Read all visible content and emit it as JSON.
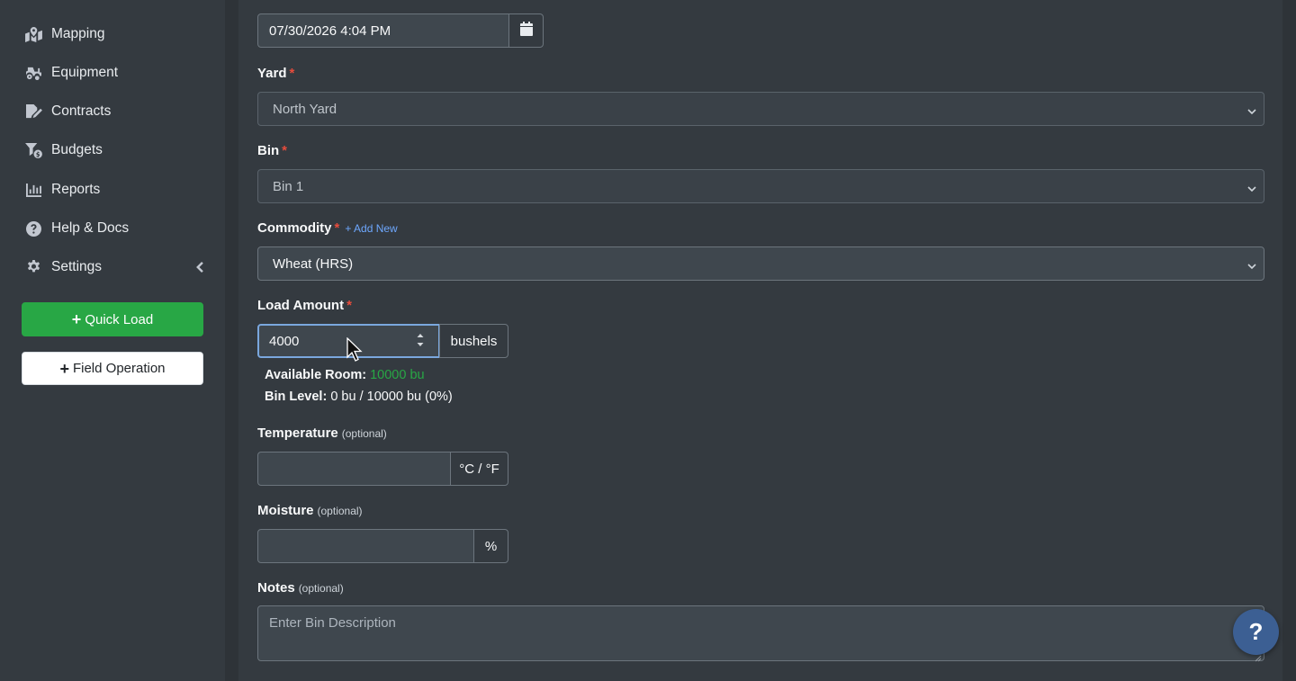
{
  "sidebar": {
    "items": [
      {
        "label": "Mapping",
        "icon": "map-marked-icon"
      },
      {
        "label": "Equipment",
        "icon": "tractor-icon"
      },
      {
        "label": "Contracts",
        "icon": "file-signature-icon"
      },
      {
        "label": "Budgets",
        "icon": "budget-funnel-icon"
      },
      {
        "label": "Reports",
        "icon": "chart-bar-icon"
      },
      {
        "label": "Help & Docs",
        "icon": "question-circle-icon"
      },
      {
        "label": "Settings",
        "icon": "gear-icon"
      }
    ],
    "quick_load_label": "Quick Load",
    "field_operation_label": "Field Operation"
  },
  "form": {
    "date_time": {
      "value": "07/30/2026 4:04 PM"
    },
    "yard": {
      "label": "Yard",
      "required": "*",
      "value": "North Yard"
    },
    "bin": {
      "label": "Bin",
      "required": "*",
      "value": "Bin 1"
    },
    "commodity": {
      "label": "Commodity",
      "required": "*",
      "add_new": "+ Add New",
      "value": "Wheat (HRS)"
    },
    "load_amount": {
      "label": "Load Amount",
      "required": "*",
      "value": "4000",
      "unit": "bushels"
    },
    "available_room": {
      "label": "Available Room:",
      "value": "10000 bu"
    },
    "bin_level": {
      "label": "Bin Level:",
      "value": "0 bu / 10000 bu (0%)"
    },
    "temperature": {
      "label": "Temperature",
      "optional": "(optional)",
      "unit": "°C / °F",
      "value": ""
    },
    "moisture": {
      "label": "Moisture",
      "optional": "(optional)",
      "unit": "%",
      "value": ""
    },
    "notes": {
      "label": "Notes",
      "optional": "(optional)",
      "placeholder": "Enter Bin Description"
    }
  },
  "help_button_label": "?",
  "colors": {
    "success": "#28a745",
    "required": "#e74c3c",
    "link": "#6ea8fe",
    "help": "#3c5f93"
  }
}
